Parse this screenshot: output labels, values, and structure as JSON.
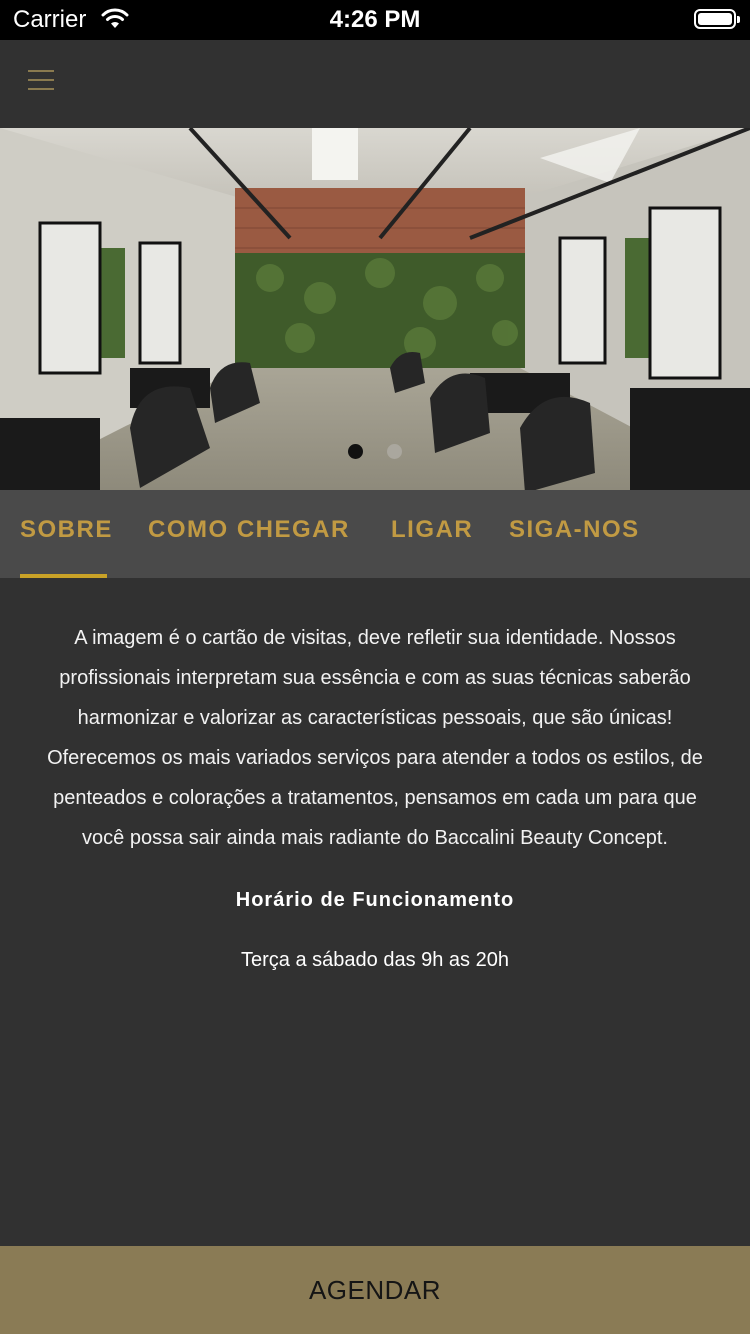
{
  "status_bar": {
    "carrier": "Carrier",
    "time": "4:26 PM"
  },
  "nav": {
    "menu_icon": "hamburger-menu-icon"
  },
  "hero": {
    "image_description": "salon interior",
    "carousel": {
      "current": 1,
      "total": 2
    }
  },
  "tabs": [
    {
      "label": "SOBRE",
      "active": true
    },
    {
      "label": "COMO CHEGAR",
      "active": false
    },
    {
      "label": "LIGAR",
      "active": false
    },
    {
      "label": "SIGA-NOS",
      "active": false
    }
  ],
  "about": {
    "text": "A imagem é o cartão de visitas, deve refletir sua identidade. Nossos profissionais interpretam sua essência e com as suas técnicas saberão harmonizar e valorizar as características pessoais, que são únicas! Oferecemos os mais variados serviços para atender a todos os estilos, de penteados e colorações a tratamentos, pensamos em cada um para que você possa sair ainda mais radiante do Baccalini Beauty Concept.",
    "hours_title": "Horário de Funcionamento",
    "hours": "Terça a sábado das 9h as 20h"
  },
  "cta": {
    "label": "AGENDAR"
  },
  "colors": {
    "background": "#313131",
    "tab_bar": "#4a4a4a",
    "accent": "#c19a43",
    "cta_background": "#8a7b55"
  }
}
